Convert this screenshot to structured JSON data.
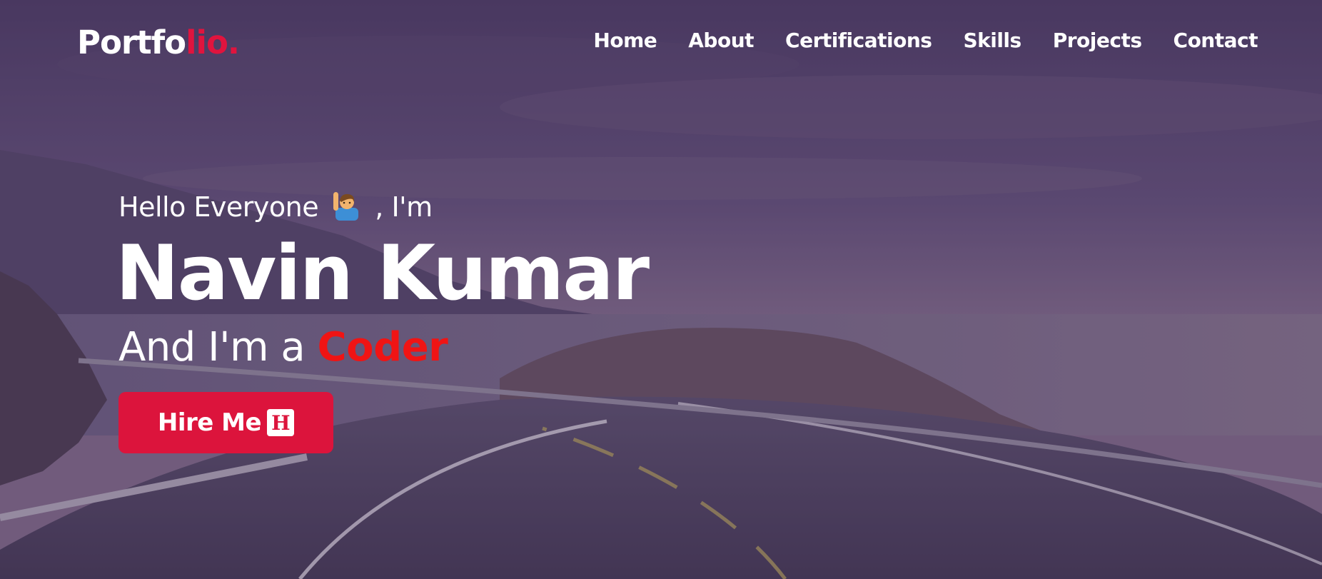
{
  "brand": {
    "logo_main": "Portfo",
    "logo_accent": "lio."
  },
  "nav": {
    "items": [
      {
        "label": "Home"
      },
      {
        "label": "About"
      },
      {
        "label": "Certifications"
      },
      {
        "label": "Skills"
      },
      {
        "label": "Projects"
      },
      {
        "label": "Contact"
      }
    ]
  },
  "hero": {
    "greeting_before": "Hello Everyone",
    "greeting_after": ", I'm",
    "emoji_icon": "person-raising-hand-icon",
    "name": "Navin Kumar",
    "tagline_prefix": "And I'm a",
    "role": "Coder",
    "cta_label": "Hire Me",
    "cta_icon_glyph": "H"
  },
  "colors": {
    "accent": "#dc143c",
    "role_text": "#f01414",
    "overlay": "#3c285a"
  }
}
